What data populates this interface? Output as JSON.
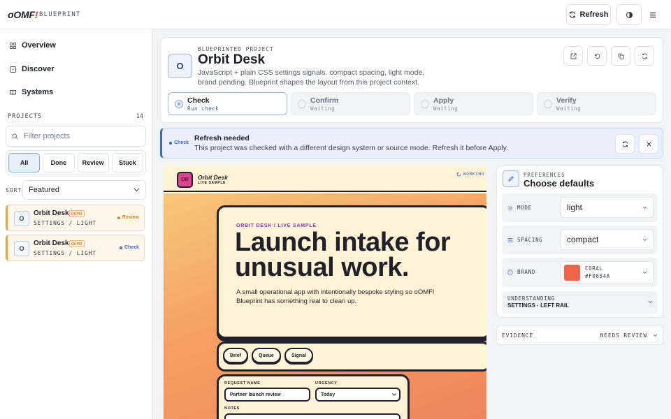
{
  "app": {
    "logo_main": "oOMF",
    "logo_bang": "!",
    "logo_sub": "BLUEPRINT"
  },
  "toolbar": {
    "refresh_label": "Refresh"
  },
  "sidebar": {
    "nav": [
      {
        "label": "Overview",
        "icon": "grid-icon"
      },
      {
        "label": "Discover",
        "icon": "compass-icon"
      },
      {
        "label": "Systems",
        "icon": "book-icon"
      }
    ],
    "projects_heading": "PROJECTS",
    "projects_count": "14",
    "filter_placeholder": "Filter projects",
    "segments": [
      "All",
      "Done",
      "Review",
      "Stuck"
    ],
    "active_segment": "All",
    "sort_label": "SORT",
    "sort_value": "Featured",
    "projects": [
      {
        "avatar": "O",
        "name": "Orbit Desk",
        "badge": "DEMO",
        "subtitle": "SETTINGS / LIGHT",
        "status": "Review",
        "status_color": "#d98a1f"
      },
      {
        "avatar": "O",
        "name": "Orbit Desk",
        "badge": "DEMO",
        "subtitle": "SETTINGS / LIGHT",
        "status": "Check",
        "status_color": "#3d67c2"
      }
    ]
  },
  "project": {
    "avatar": "O",
    "kicker": "BLUEPRINTED PROJECT",
    "title": "Orbit Desk",
    "description": "JavaScript + plain CSS settings signals. compact spacing, light mode, brand pending. Blueprint shapes the layout from this project context.",
    "steps": [
      {
        "label": "Check",
        "sub": "Run check",
        "active": true
      },
      {
        "label": "Confirm",
        "sub": "Waiting",
        "active": false
      },
      {
        "label": "Apply",
        "sub": "Waiting",
        "active": false
      },
      {
        "label": "Verify",
        "sub": "Waiting",
        "active": false
      }
    ]
  },
  "alert": {
    "badge": "Check",
    "title": "Refresh needed",
    "message": "This project was checked with a different design system or source mode. Refresh it before Apply."
  },
  "preview": {
    "logo": "OD",
    "name": "Orbit Desk",
    "sub": "LIVE SAMPLE",
    "status": "WORKING",
    "hero_kicker": "ORBIT DESK / LIVE SAMPLE",
    "hero_title": "Launch intake for unusual work.",
    "hero_text": "A small operational app with intentionally bespoke styling so oOMF! Blueprint has something real to clean up.",
    "pills": [
      "Brief",
      "Queue",
      "Signal"
    ],
    "form": {
      "request_label": "REQUEST NAME",
      "request_value": "Partner launch review",
      "urgency_label": "URGENCY",
      "urgency_value": "Today",
      "notes_label": "NOTES"
    }
  },
  "preferences": {
    "kicker": "PREFERENCES",
    "title": "Choose defaults",
    "mode_label": "MODE",
    "mode_value": "light",
    "spacing_label": "SPACING",
    "spacing_value": "compact",
    "brand_label": "BRAND",
    "brand_name": "CORAL",
    "brand_hex": "#F0654A",
    "brand_color": "#f0654a",
    "understanding_label": "UNDERSTANDING",
    "understanding_value": "SETTINGS · LEFT RAIL"
  },
  "evidence": {
    "label": "EVIDENCE",
    "status": "NEEDS REVIEW"
  }
}
